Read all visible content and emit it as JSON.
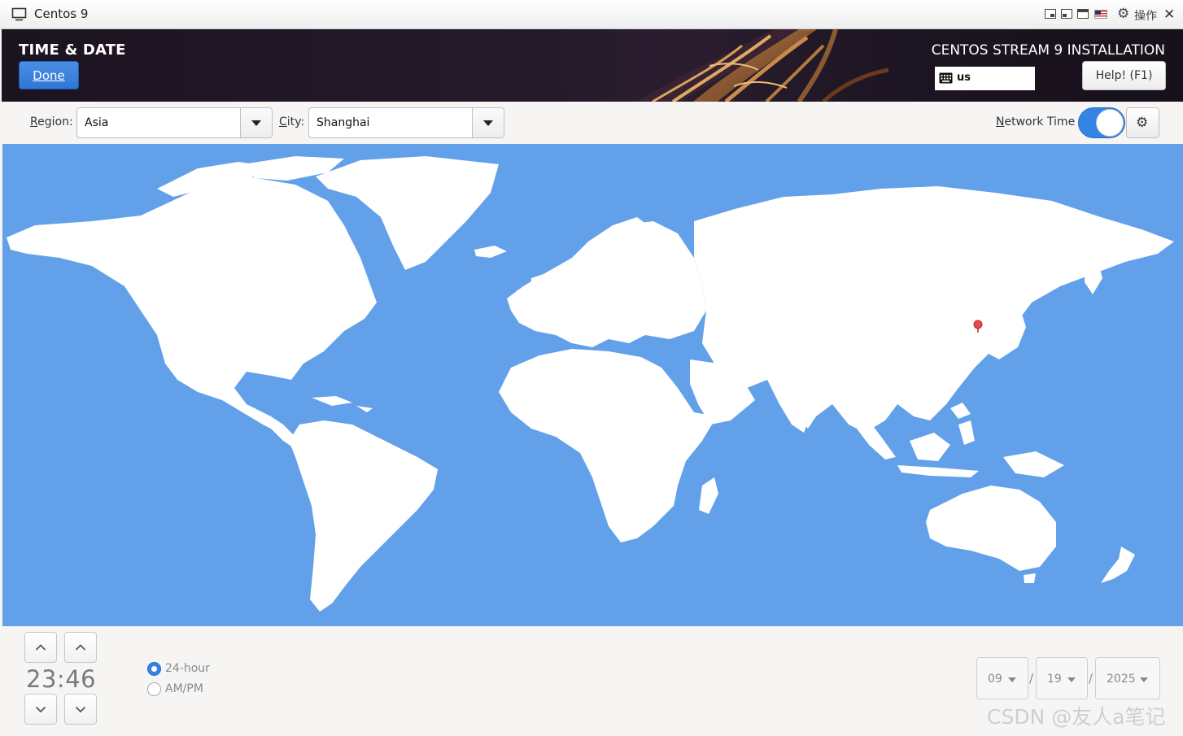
{
  "vm_window": {
    "title": "Centos 9",
    "actions_label": "操作",
    "icons": [
      "computer-icon",
      "restore-icon",
      "minimize-icon",
      "maximize-icon",
      "us-flag-icon",
      "gear-icon",
      "close-icon"
    ]
  },
  "header": {
    "spoke_title": "TIME & DATE",
    "done_label": "Done",
    "installation_title": "CENTOS STREAM 9 INSTALLATION",
    "keyboard_layout": "us",
    "help_label": "Help! (F1)"
  },
  "toolbar": {
    "region_label_prefix": "R",
    "region_label_rest": "egion:",
    "region_value": "Asia",
    "city_label_prefix": "C",
    "city_label_rest": "ity:",
    "city_value": "Shanghai",
    "network_time_prefix": "N",
    "network_time_rest": "etwork Time",
    "network_time_enabled": true
  },
  "map": {
    "selected_city": "Shanghai",
    "ocean_color": "#62a0ea",
    "land_color": "#ffffff",
    "marker_color": "#e5484d"
  },
  "time": {
    "hours": "23",
    "separator": ":",
    "minutes": "46",
    "format_24h_label": "24-hour",
    "format_ampm_label": "AM/PM",
    "selected_format": "24-hour"
  },
  "date": {
    "month": "09",
    "day": "19",
    "year": "2025",
    "separator": "/"
  },
  "watermark": "CSDN @友人a笔记",
  "colors": {
    "accent": "#3584e4",
    "header_bg": "#1f1624"
  }
}
